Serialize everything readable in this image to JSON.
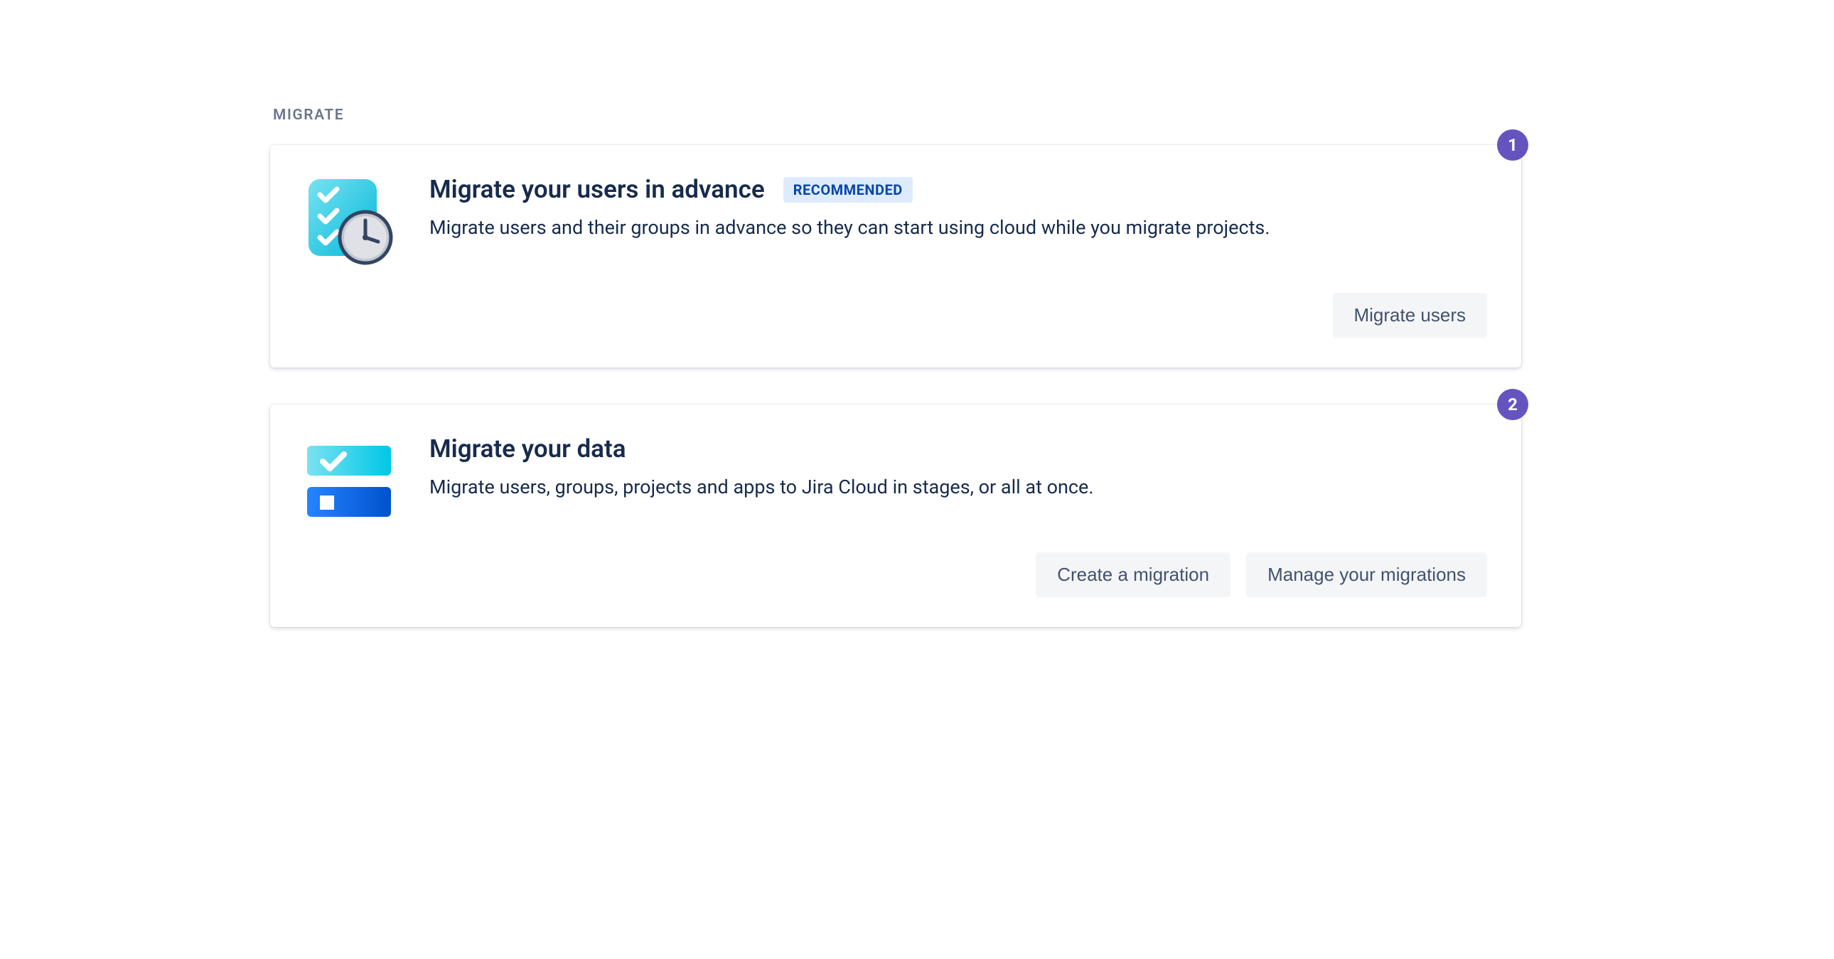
{
  "section_label": "MIGRATE",
  "cards": [
    {
      "step": "1",
      "title": "Migrate your users in advance",
      "badge": "RECOMMENDED",
      "description": "Migrate users and their groups in advance so they can start using cloud while you migrate projects.",
      "buttons": {
        "migrate_users": "Migrate users"
      }
    },
    {
      "step": "2",
      "title": "Migrate your data",
      "description": "Migrate users, groups, projects and apps to Jira Cloud in stages, or all at once.",
      "buttons": {
        "create": "Create a migration",
        "manage": "Manage your migrations"
      }
    }
  ]
}
